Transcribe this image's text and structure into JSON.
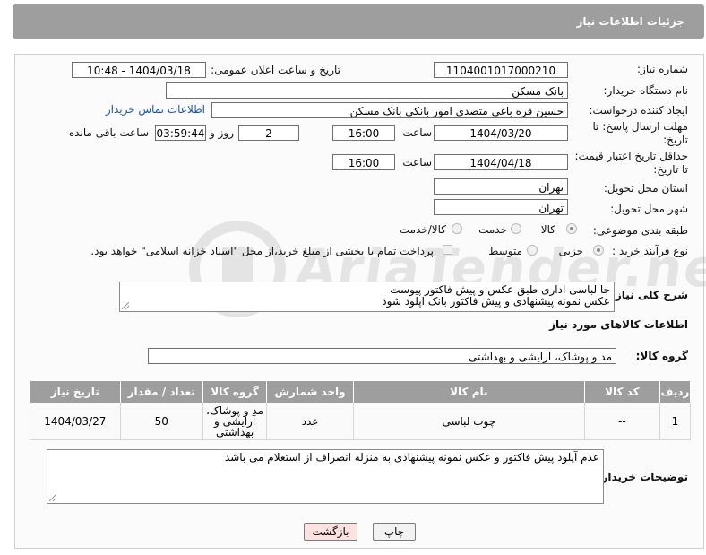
{
  "header": {
    "title": "جزئیات اطلاعات نیاز"
  },
  "watermark": {
    "text": "AriaTender.neT"
  },
  "fields": {
    "need_number_label": "شماره نیاز:",
    "need_number": "1104001017000210",
    "announce_label": "تاریخ و ساعت اعلان عمومی:",
    "announce_value": "1404/03/18 - 10:48",
    "buyer_org_label": "نام دستگاه خریدار:",
    "buyer_org": "بانک مسکن",
    "creator_label": "ایجاد کننده درخواست:",
    "creator": "حسین  قره باغی متصدی امور بانکی بانک مسکن",
    "contact_link": "اطلاعات تماس خریدار",
    "deadline_label": "مهلت ارسال پاسخ: تا تاریخ:",
    "deadline_date": "1404/03/20",
    "time_label": "ساعت",
    "deadline_time": "16:00",
    "days_count": "2",
    "days_label": "روز و",
    "remaining_time": "03:59:44",
    "remaining_label": "ساعت باقی مانده",
    "min_validity_label": "حداقل تاریخ اعتبار قیمت: تا تاریخ:",
    "validity_date": "1404/04/18",
    "validity_time": "16:00",
    "province_label": "استان محل تحویل:",
    "province": "تهران",
    "city_label": "شهر محل تحویل:",
    "city": "تهران",
    "category_label": "طبقه بندی موضوعی:",
    "category_options": [
      "کالا",
      "خدمت",
      "کالا/خدمت"
    ],
    "category_selected": "کالا",
    "process_label": "نوع فرآیند خرید :",
    "process_options": [
      "جزیی",
      "متوسط"
    ],
    "process_selected": "جزیی",
    "payment_note": "پرداخت تمام یا بخشی از مبلغ خرید،از محل \"اسناد خزانه اسلامی\" خواهد بود.",
    "description_label": "شرح کلی نیاز:",
    "description_lines": [
      "جا لباسی اداری طبق عکس و پیش فاکتور پیوست",
      "عکس نمونه پیشنهادی و پیش فاکتور بانک اپلود شود"
    ],
    "goods_info_title": "اطلاعات کالاهای مورد نیاز",
    "goods_group_label": "گروه کالا:",
    "goods_group": "مد و پوشاک، آرایشی و بهداشتی"
  },
  "table": {
    "headers": [
      "ردیف",
      "کد کالا",
      "نام کالا",
      "واحد شمارش",
      "گروه کالا",
      "تعداد / مقدار",
      "تاریخ نیاز"
    ],
    "rows": [
      {
        "row": "1",
        "code": "--",
        "name": "چوب لباسی",
        "unit": "عدد",
        "group": "مد و پوشاک، آرایشی و بهداشتی",
        "qty": "50",
        "date": "1404/03/27"
      }
    ]
  },
  "buyer_notes": {
    "label": "توضیحات خریدار:",
    "text": "عدم آپلود پیش فاکتور و عکس نمونه پیشنهادی به منزله انصراف از استعلام می باشد"
  },
  "buttons": {
    "print": "چاپ",
    "back": "بازگشت"
  },
  "colors": {
    "header_bg": "#9e9e9e",
    "link": "#1a55a5",
    "back_button_bg": "#fde2e2"
  }
}
